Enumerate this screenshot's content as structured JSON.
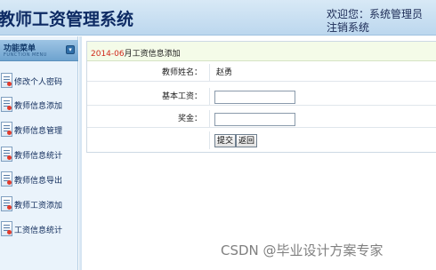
{
  "header": {
    "title": "教师工资管理系统",
    "welcome": "欢迎您：系统管理员",
    "logout": "注销系统"
  },
  "sidebar": {
    "title": "功能菜单",
    "subtitle": "FUNCTION MENU",
    "items": [
      {
        "label": "修改个人密码",
        "icon": "document-icon"
      },
      {
        "label": "教师信息添加",
        "icon": "document-icon"
      },
      {
        "label": "教师信息管理",
        "icon": "document-icon"
      },
      {
        "label": "教师信息统计",
        "icon": "document-icon"
      },
      {
        "label": "教师信息导出",
        "icon": "document-icon"
      },
      {
        "label": "教师工资添加",
        "icon": "document-icon"
      },
      {
        "label": "工资信息统计",
        "icon": "document-icon"
      }
    ]
  },
  "form": {
    "month": "2014-06",
    "heading": "月工资信息添加",
    "teacher_name_label": "教师姓名：",
    "teacher_name_value": "赵勇",
    "base_salary_label": "基本工资：",
    "base_salary_value": "",
    "bonus_label": "奖金：",
    "bonus_value": "",
    "submit_label": "提交",
    "back_label": "返回"
  },
  "watermark": "CSDN @毕业设计方案专家",
  "colors": {
    "header_bg": "#bcd7ee",
    "title": "#0d2a63",
    "month_red": "#d02a1c",
    "form_head_bg": "#f4fbe8"
  }
}
